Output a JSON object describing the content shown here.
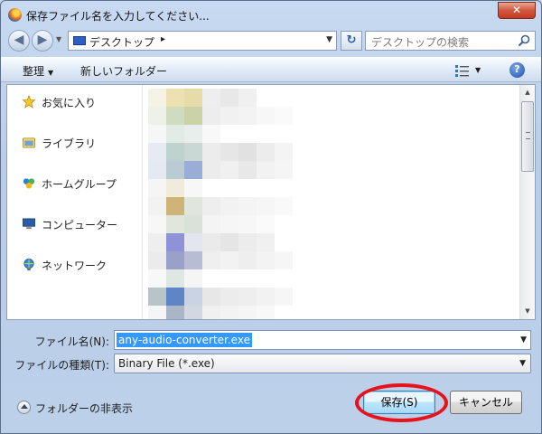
{
  "window": {
    "title": "保存ファイル名を入力してください...",
    "close_label": "✕"
  },
  "address": {
    "location": "デスクトップ",
    "separator": "▸",
    "search_placeholder": "デスクトップの検索"
  },
  "toolbar": {
    "organize_label": "整理",
    "new_folder_label": "新しいフォルダー",
    "help_label": "?"
  },
  "navigation": {
    "items": [
      {
        "label": "お気に入り",
        "icon": "star-icon"
      },
      {
        "label": "ライブラリ",
        "icon": "library-icon"
      },
      {
        "label": "ホームグループ",
        "icon": "homegroup-icon"
      },
      {
        "label": "コンピューター",
        "icon": "computer-icon"
      },
      {
        "label": "ネットワーク",
        "icon": "network-icon"
      }
    ]
  },
  "form": {
    "filename_label": "ファイル名(N):",
    "filename_value": "any-audio-converter.exe",
    "filetype_label": "ファイルの種類(T):",
    "filetype_value": "Binary File (*.exe)"
  },
  "footer": {
    "hide_folders_label": "フォルダーの非表示",
    "save_label": "保存(S)",
    "cancel_label": "キャンセル"
  },
  "colors": {
    "selection": "#3399ff",
    "highlight_ring": "#e8121b"
  }
}
